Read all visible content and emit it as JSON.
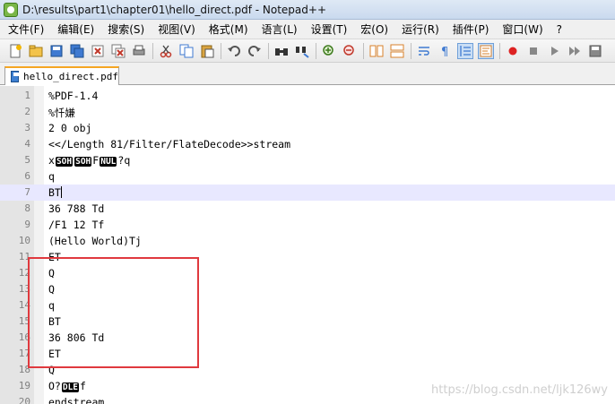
{
  "window": {
    "title": "D:\\results\\part1\\chapter01\\hello_direct.pdf - Notepad++"
  },
  "menu": [
    "文件(F)",
    "编辑(E)",
    "搜索(S)",
    "视图(V)",
    "格式(M)",
    "语言(L)",
    "设置(T)",
    "宏(O)",
    "运行(R)",
    "插件(P)",
    "窗口(W)",
    "?"
  ],
  "toolbar": {
    "icons": [
      "new-file-icon",
      "open-file-icon",
      "save-icon",
      "save-all-icon",
      "close-icon",
      "close-all-icon",
      "print-icon",
      "cut-icon",
      "copy-icon",
      "paste-icon",
      "undo-icon",
      "redo-icon",
      "find-icon",
      "replace-icon",
      "zoom-in-icon",
      "zoom-out-icon",
      "sync-vertical-icon",
      "sync-horizontal-icon",
      "word-wrap-icon",
      "show-all-chars-icon",
      "indent-guide-icon",
      "document-map-icon",
      "record-macro-icon",
      "stop-record-icon",
      "play-macro-icon",
      "run-multiple-icon",
      "save-macro-icon"
    ]
  },
  "tabs": [
    {
      "label": "hello_direct.pdf",
      "icon": "saved-file-icon"
    }
  ],
  "editor": {
    "current_line": 7,
    "lines": [
      {
        "n": "1",
        "parts": [
          {
            "t": "%PDF-1.4"
          }
        ]
      },
      {
        "n": "2",
        "parts": [
          {
            "t": "%忏嫌"
          }
        ]
      },
      {
        "n": "3",
        "parts": [
          {
            "t": "2 0 obj"
          }
        ]
      },
      {
        "n": "4",
        "parts": [
          {
            "t": "<</Length 81/Filter/FlateDecode>>stream"
          }
        ]
      },
      {
        "n": "5",
        "parts": [
          {
            "t": "x"
          },
          {
            "c": "SOH"
          },
          {
            "c": "SOH"
          },
          {
            "t": "F"
          },
          {
            "c": "NUL"
          },
          {
            "t": "?q"
          }
        ]
      },
      {
        "n": "6",
        "parts": [
          {
            "t": "q"
          }
        ]
      },
      {
        "n": "7",
        "parts": [
          {
            "t": "BT"
          }
        ]
      },
      {
        "n": "8",
        "parts": [
          {
            "t": "36 788 Td"
          }
        ]
      },
      {
        "n": "9",
        "parts": [
          {
            "t": "/F1 12 Tf"
          }
        ]
      },
      {
        "n": "10",
        "parts": [
          {
            "t": "(Hello World)Tj"
          }
        ]
      },
      {
        "n": "11",
        "parts": [
          {
            "t": "ET"
          }
        ]
      },
      {
        "n": "12",
        "parts": [
          {
            "t": "Q"
          }
        ]
      },
      {
        "n": "13",
        "parts": [
          {
            "t": "Q"
          }
        ]
      },
      {
        "n": "14",
        "parts": [
          {
            "t": "q"
          }
        ]
      },
      {
        "n": "15",
        "parts": [
          {
            "t": "BT"
          }
        ]
      },
      {
        "n": "16",
        "parts": [
          {
            "t": "36 806 Td"
          }
        ]
      },
      {
        "n": "17",
        "parts": [
          {
            "t": "ET"
          }
        ]
      },
      {
        "n": "18",
        "parts": [
          {
            "t": "Q"
          }
        ]
      },
      {
        "n": "19",
        "parts": [
          {
            "t": "O?"
          },
          {
            "c": "DLE"
          },
          {
            "t": "f"
          }
        ]
      },
      {
        "n": "20",
        "parts": [
          {
            "t": "endstream"
          }
        ]
      }
    ]
  },
  "annotation": {
    "color": "#e0393e"
  },
  "watermark": "https://blog.csdn.net/ljk126wy"
}
